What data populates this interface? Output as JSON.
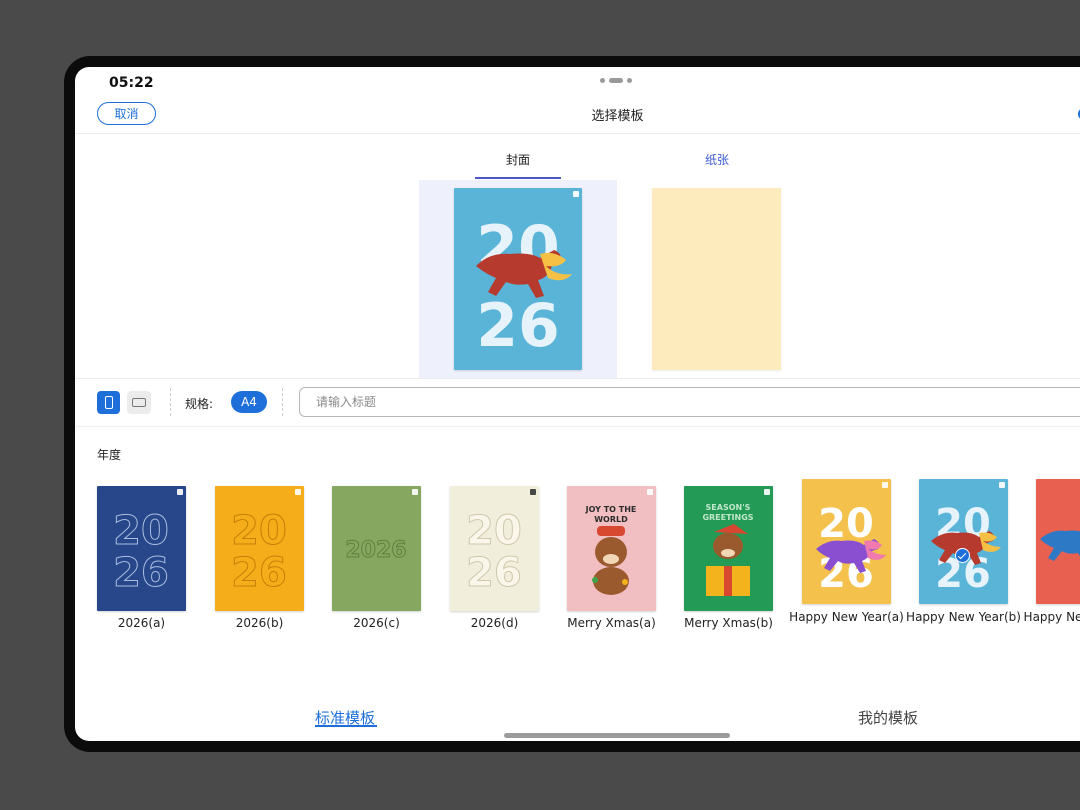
{
  "status": {
    "time": "05:22"
  },
  "header": {
    "cancel_label": "取消",
    "title": "选择模板"
  },
  "tabs": [
    {
      "label": "封面",
      "active": true
    },
    {
      "label": "纸张",
      "active": false
    }
  ],
  "toolbar": {
    "spec_label": "规格:",
    "spec_value": "A4",
    "title_placeholder": "请输入标题"
  },
  "section": {
    "label": "年度"
  },
  "templates": [
    {
      "name": "2026(a)",
      "color": "#27478a"
    },
    {
      "name": "2026(b)",
      "color": "#f6ad1a"
    },
    {
      "name": "2026(c)",
      "color": "#86a760"
    },
    {
      "name": "2026(d)",
      "color": "#f2eedc"
    },
    {
      "name": "Merry Xmas(a)",
      "color": "#f1bfc2",
      "title_art": "JOY TO THE WORLD"
    },
    {
      "name": "Merry Xmas(b)",
      "color": "#239a56",
      "title_art": "SEASON'S GREETINGS"
    },
    {
      "name": "Happy New Year(a)",
      "color": "#f3c14c"
    },
    {
      "name": "Happy New Year(b)",
      "color": "#5ab4d8",
      "selected": true
    },
    {
      "name": "Happy New Year(c)",
      "color": "#e8604f"
    }
  ],
  "bottom_tabs": [
    {
      "label": "标准模板",
      "active": true
    },
    {
      "label": "我的模板",
      "active": false
    }
  ],
  "colors": {
    "accent": "#1e6fd9",
    "tab_indicator": "#4b57c9",
    "paper": "#fdebbd"
  }
}
